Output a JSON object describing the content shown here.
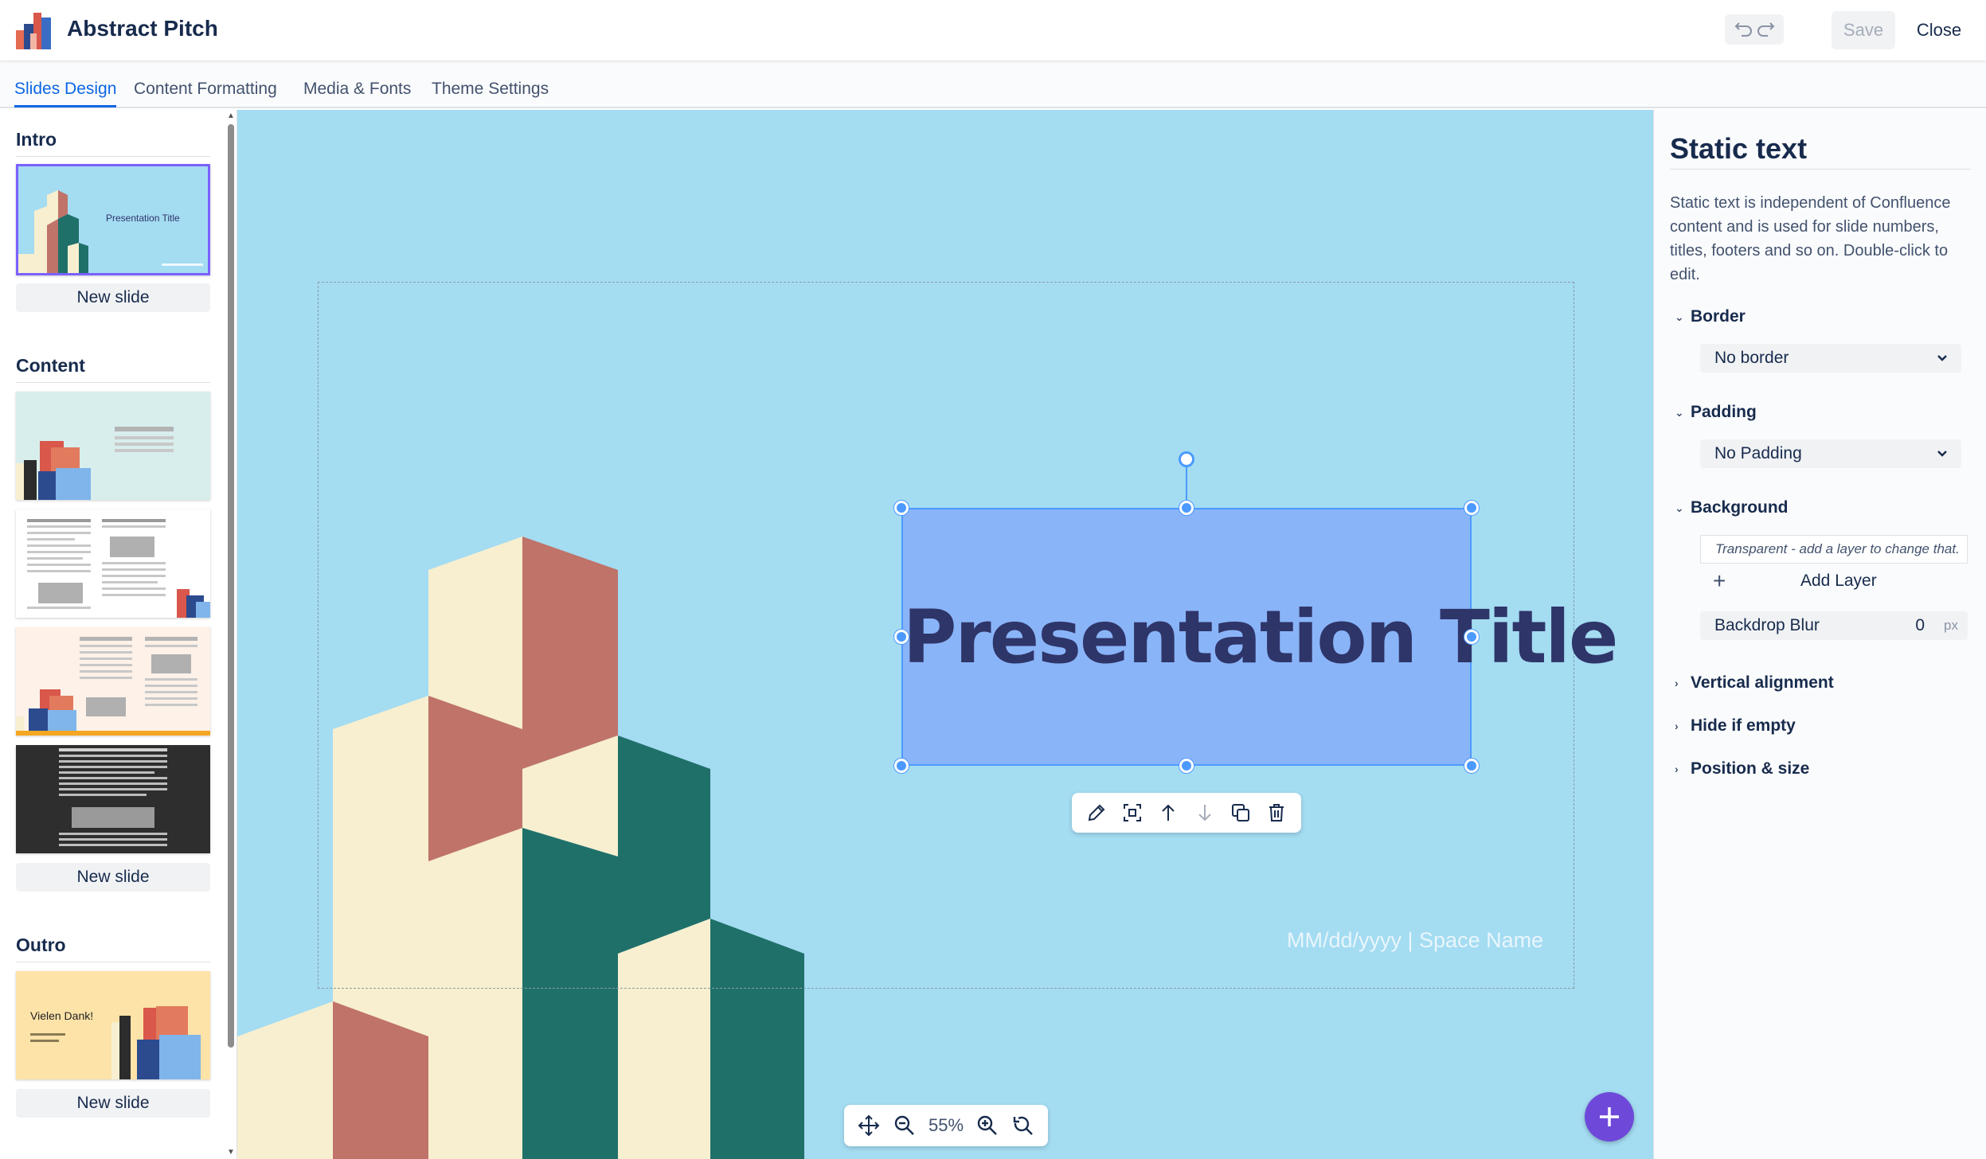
{
  "header": {
    "app_title": "Abstract Pitch",
    "save_label": "Save",
    "close_label": "Close"
  },
  "tabs": [
    {
      "label": "Slides Design",
      "active": true
    },
    {
      "label": "Content Formatting",
      "active": false
    },
    {
      "label": "Media & Fonts",
      "active": false
    },
    {
      "label": "Theme Settings",
      "active": false
    }
  ],
  "left_panel": {
    "sections": [
      {
        "title": "Intro",
        "new_slide_label": "New slide",
        "thumb_text": "Presentation Title"
      },
      {
        "title": "Content",
        "new_slide_label": "New slide"
      },
      {
        "title": "Outro",
        "new_slide_label": "New slide",
        "thumb_text": "Vielen Dank!"
      }
    ]
  },
  "canvas": {
    "title_text": "Presentation Title",
    "footer_text": "MM/dd/yyyy | Space Name",
    "zoom_level": "55%",
    "colors": {
      "background": "#a4dcf2",
      "text_box": "#8ab4f8",
      "title": "#2e3569",
      "cream": "#f7efcf",
      "terracotta": "#bf7369",
      "teal": "#20706a"
    }
  },
  "right_panel": {
    "title": "Static text",
    "description": "Static text is independent of Confluence content and is used for slide numbers, titles, footers and so on. Double-click to edit.",
    "border": {
      "label": "Border",
      "value": "No border"
    },
    "padding": {
      "label": "Padding",
      "value": "No Padding"
    },
    "background": {
      "label": "Background",
      "hint": "Transparent - add a layer to change that.",
      "add_layer_label": "Add Layer",
      "backdrop_blur_label": "Backdrop Blur",
      "backdrop_blur_value": "0",
      "backdrop_blur_unit": "px"
    },
    "collapsed_sections": [
      "Vertical alignment",
      "Hide if empty",
      "Position & size"
    ]
  }
}
